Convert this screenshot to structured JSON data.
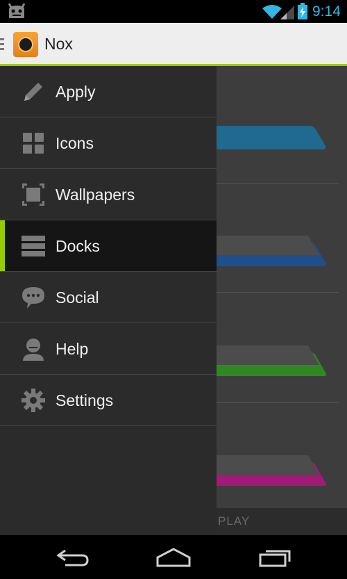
{
  "status_bar": {
    "time": "9:14",
    "icons": [
      "android-icon",
      "wifi-icon",
      "signal-icon",
      "battery-charging-icon"
    ],
    "accent_color": "#33b5e5"
  },
  "action_bar": {
    "title": "Nox",
    "accent_color": "#99cc00"
  },
  "drawer": {
    "items": [
      {
        "label": "Apply",
        "icon": "pencil-icon",
        "active": false
      },
      {
        "label": "Icons",
        "icon": "grid-icon",
        "active": false
      },
      {
        "label": "Wallpapers",
        "icon": "wallpaper-frame-icon",
        "active": false
      },
      {
        "label": "Docks",
        "icon": "docks-icon",
        "active": true
      },
      {
        "label": "Social",
        "icon": "chat-bubble-icon",
        "active": false
      },
      {
        "label": "Help",
        "icon": "help-person-icon",
        "active": false
      },
      {
        "label": "Settings",
        "icon": "gear-icon",
        "active": false
      }
    ]
  },
  "content": {
    "dock_colors": [
      "#1f6a8e",
      "#1d4f8f",
      "#2e8a1f",
      "#a01a76"
    ],
    "play_label": "PLAY"
  },
  "nav_bar": {
    "buttons": [
      "back-icon",
      "home-icon",
      "recents-icon"
    ]
  }
}
